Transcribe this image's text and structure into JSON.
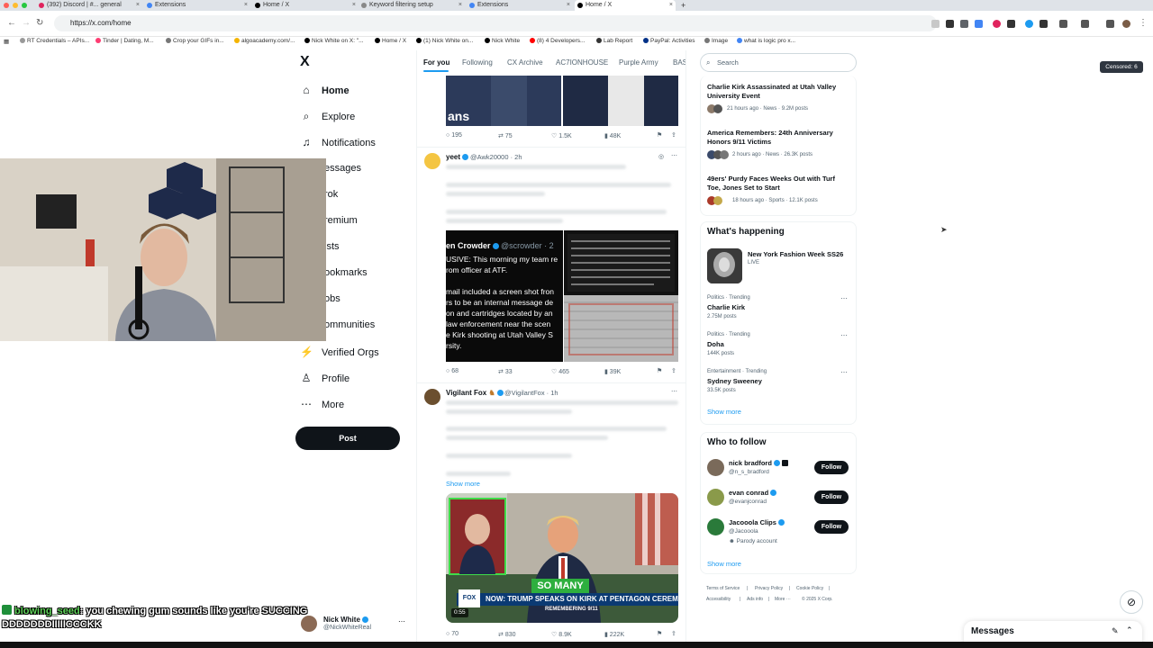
{
  "browser": {
    "tabs": [
      {
        "label": "(392) Discord | #... general",
        "color": "#5865f2"
      },
      {
        "label": "Extensions",
        "color": "#4285f4"
      },
      {
        "label": "Home / X",
        "color": "#000000"
      },
      {
        "label": "Keyword filtering setup",
        "color": "#888888"
      },
      {
        "label": "Extensions",
        "color": "#4285f4"
      },
      {
        "label": "Home / X",
        "color": "#000000",
        "active": true
      }
    ],
    "new_tab": "+",
    "url": "https://x.com/home",
    "bookmarks": [
      "RT Credentials – APIs...",
      "Tinder | Dating, M...",
      "Crop your GIFs in...",
      "algoacademy.com/...",
      "Nick White on X: \"...",
      "Home / X",
      "(1) Nick White on...",
      "Nick White",
      "(8) 4 Developers...",
      "Lab Report",
      "PayPal: Activities",
      "Image",
      "what is logic pro x..."
    ]
  },
  "nav": {
    "logo": "X",
    "items": [
      {
        "label": "Home",
        "icon": "⌂",
        "name": "home-icon"
      },
      {
        "label": "Explore",
        "icon": "⌕",
        "name": "search-icon"
      },
      {
        "label": "Notifications",
        "icon": "♫",
        "name": "bell-icon"
      },
      {
        "label": "Messages",
        "icon": "✉",
        "name": "mail-icon"
      },
      {
        "label": "Grok",
        "icon": "◪",
        "name": "grok-icon"
      },
      {
        "label": "Premium",
        "icon": "✕",
        "name": "premium-icon"
      },
      {
        "label": "Lists",
        "icon": "☰",
        "name": "list-icon"
      },
      {
        "label": "Bookmarks",
        "icon": "⚑",
        "name": "bookmark-icon"
      },
      {
        "label": "Jobs",
        "icon": "▣",
        "name": "briefcase-icon"
      },
      {
        "label": "Communities",
        "icon": "☺",
        "name": "community-icon"
      },
      {
        "label": "Verified Orgs",
        "icon": "⚡",
        "name": "lightning-icon"
      },
      {
        "label": "Profile",
        "icon": "♙",
        "name": "profile-icon"
      },
      {
        "label": "More",
        "icon": "⋯",
        "name": "more-icon"
      }
    ],
    "nav_cropped": [
      "Messages",
      "Grok",
      "Premium",
      "Lists",
      "Bookmarks",
      "Jobs",
      "Communities"
    ],
    "nav_visible": [
      "essages",
      "rok",
      "remium",
      "ists",
      "ookmarks",
      "obs",
      "ommunities"
    ],
    "post": "Post",
    "account": {
      "name": "Nick White",
      "handle": "@NickWhiteReal"
    }
  },
  "feed": {
    "tabs": [
      "For you",
      "Following",
      "CX Archive",
      "AC7IONHOUSE",
      "Purple Army",
      "BAS"
    ],
    "post1_stats": {
      "replies": "195",
      "reposts": "75",
      "likes": "1.5K",
      "views": "48K"
    },
    "post2": {
      "name": "yeet",
      "handle": "@Awk20000 · 2h",
      "quote_name": "en Crowder",
      "quote_handle": "@scrowder · 2",
      "quote_lines": [
        "USIVE: This morning my team re",
        "rom officer at ATF.",
        "",
        "mail included a screen shot fron",
        "rs to be an internal message de",
        "on and cartridges located by an",
        "law enforcement near the scen",
        "e Kirk shooting  at Utah Valley S",
        "rsity."
      ],
      "stats": {
        "replies": "68",
        "reposts": "33",
        "likes": "465",
        "views": "39K"
      }
    },
    "post3": {
      "name": "Vigilant Fox",
      "handle": "@VigilantFox · 1h",
      "show_more": "Show more",
      "banner": "SO MANY",
      "lower_third": "NOW: TRUMP SPEAKS ON KIRK AT PENTAGON CEREMONY",
      "sub": "REMEMBERING 9/11",
      "time": "0:55",
      "stats": {
        "replies": "70",
        "reposts": "830",
        "likes": "8.9K",
        "views": "222K"
      }
    }
  },
  "right": {
    "search_placeholder": "Search",
    "news": [
      {
        "title": "Charlie Kirk Assassinated at Utah Valley University Event",
        "meta": "21 hours ago · News · 9.2M posts"
      },
      {
        "title": "America Remembers: 24th Anniversary Honors 9/11 Victims",
        "meta": "2 hours ago · News · 26.3K posts"
      },
      {
        "title": "49ers' Purdy Faces Weeks Out with Turf Toe, Jones Set to Start",
        "meta": "18 hours ago · Sports · 12.1K posts"
      }
    ],
    "happening": {
      "title": "What's happening",
      "event": {
        "name": "New York Fashion Week SS26",
        "status": "LIVE"
      },
      "trends": [
        {
          "meta": "Politics · Trending",
          "name": "Charlie Kirk",
          "posts": "2.75M posts"
        },
        {
          "meta": "Politics · Trending",
          "name": "Doha",
          "posts": "144K posts"
        },
        {
          "meta": "Entertainment · Trending",
          "name": "Sydney Sweeney",
          "posts": "33.5K posts"
        }
      ],
      "show_more": "Show more"
    },
    "who_to_follow": {
      "title": "Who to follow",
      "users": [
        {
          "name": "nick bradford",
          "handle": "@n_s_bradford",
          "extra": ""
        },
        {
          "name": "evan conrad",
          "handle": "@evanjconrad",
          "extra": ""
        },
        {
          "name": "Jacooola Clips",
          "handle": "@Jacooola",
          "extra": "Parody account"
        }
      ],
      "follow": "Follow",
      "show_more": "Show more"
    },
    "footer": [
      "Terms of Service",
      "|",
      "Privacy Policy",
      "|",
      "Cookie Policy",
      "|",
      "Accessibility",
      "|",
      "Ads info",
      "|",
      "More ···",
      "© 2025 X Corp."
    ]
  },
  "overlay": {
    "censored": "Censored: 6",
    "chat_user": "blowing_seed",
    "chat_msg1": ": you chewing gum sounds like you're SUCCING",
    "chat_msg2": "DDDDDDDIIIIICCCKK",
    "messages": "Messages"
  },
  "colors": {
    "accent": "#1d9bf0",
    "text": "#0f1419",
    "muted": "#536471"
  }
}
